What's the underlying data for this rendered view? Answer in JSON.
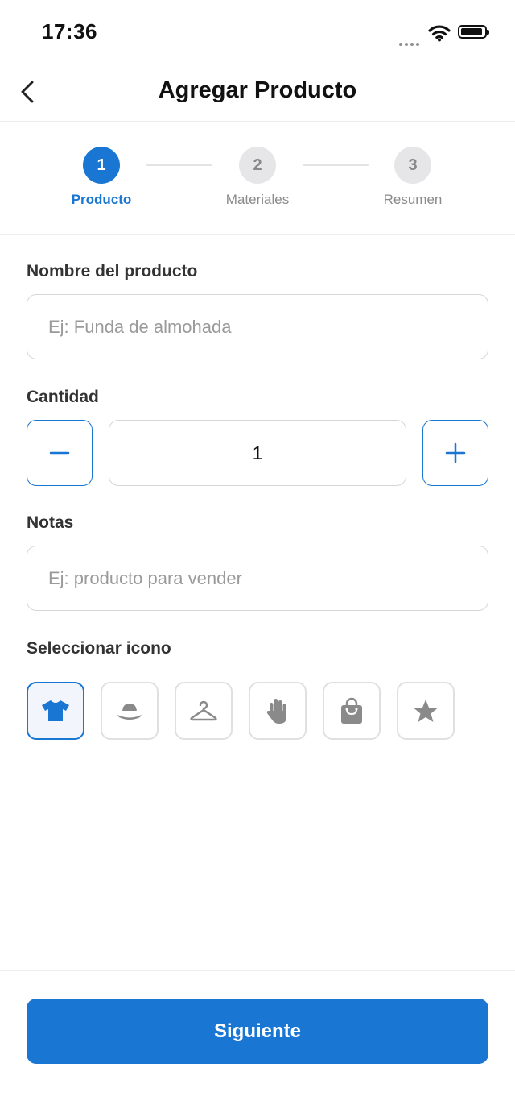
{
  "status_bar": {
    "time": "17:36"
  },
  "nav": {
    "title": "Agregar Producto"
  },
  "stepper": {
    "steps": [
      {
        "number": "1",
        "label": "Producto",
        "state": "active"
      },
      {
        "number": "2",
        "label": "Materiales",
        "state": "inactive"
      },
      {
        "number": "3",
        "label": "Resumen",
        "state": "inactive"
      }
    ]
  },
  "form": {
    "name": {
      "label": "Nombre del producto",
      "value": "",
      "placeholder": "Ej: Funda de almohada"
    },
    "quantity": {
      "label": "Cantidad",
      "value": "1"
    },
    "notes": {
      "label": "Notas",
      "value": "",
      "placeholder": "Ej: producto para vender"
    },
    "icons": {
      "label": "Seleccionar icono",
      "options": [
        "tshirt-icon",
        "hat-icon",
        "hanger-icon",
        "hand-icon",
        "shopping-bag-icon",
        "star-icon"
      ],
      "selected": "tshirt-icon"
    }
  },
  "footer": {
    "next_label": "Siguiente"
  },
  "colors": {
    "accent": "#1976d2",
    "icon_gray": "#8a8a8a",
    "border": "#d6d6d6"
  }
}
